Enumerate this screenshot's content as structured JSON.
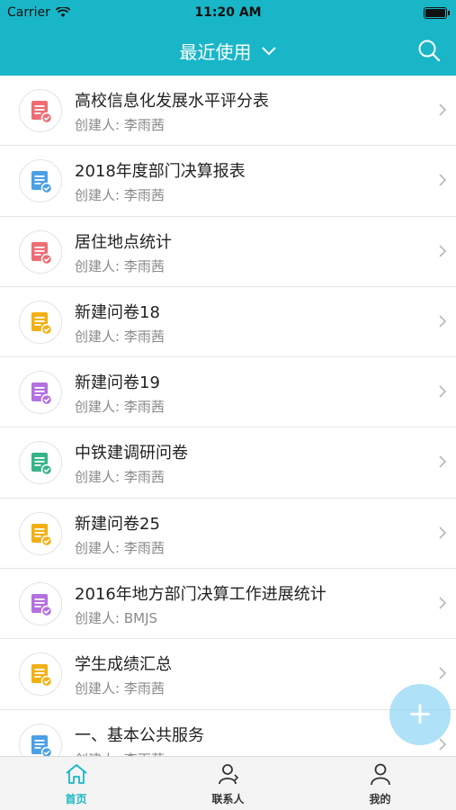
{
  "status_bar": {
    "carrier": "Carrier",
    "time": "11:20 AM"
  },
  "nav": {
    "title": "最近使用"
  },
  "creator_label": "创建人:",
  "items": [
    {
      "title": "高校信息化发展水平评分表",
      "creator": "李雨茜",
      "color": "#ef6c73"
    },
    {
      "title": "2018年度部门决算报表",
      "creator": "李雨茜",
      "color": "#4aa0e6"
    },
    {
      "title": "居住地点统计",
      "creator": "李雨茜",
      "color": "#ef6c73"
    },
    {
      "title": "新建问卷18",
      "creator": "李雨茜",
      "color": "#f2b012"
    },
    {
      "title": "新建问卷19",
      "creator": "李雨茜",
      "color": "#b46fe0"
    },
    {
      "title": "中铁建调研问卷",
      "creator": "李雨茜",
      "color": "#36b38a"
    },
    {
      "title": "新建问卷25",
      "creator": "李雨茜",
      "color": "#f2b012"
    },
    {
      "title": "2016年地方部门决算工作进展统计",
      "creator": "BMJS",
      "color": "#b46fe0"
    },
    {
      "title": "学生成绩汇总",
      "creator": "李雨茜",
      "color": "#f2b012"
    },
    {
      "title": "一、基本公共服务",
      "creator": "李雨茜",
      "color": "#4aa0e6"
    }
  ],
  "fab_icon": "plus-icon",
  "tabs": [
    {
      "label": "首页",
      "icon": "home-icon",
      "active": true
    },
    {
      "label": "联系人",
      "icon": "contacts-icon",
      "active": false
    },
    {
      "label": "我的",
      "icon": "profile-icon",
      "active": false
    }
  ],
  "colors": {
    "accent": "#19b6c8",
    "fab": "#6ec8f0"
  }
}
